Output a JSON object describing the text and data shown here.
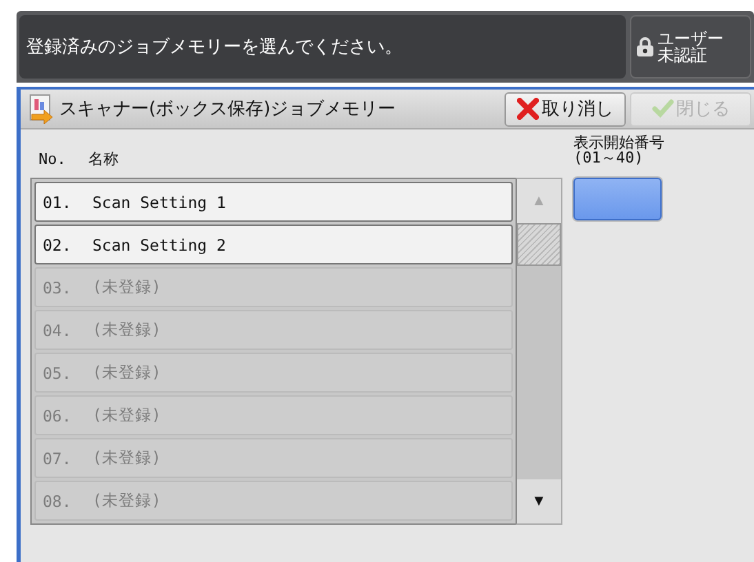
{
  "message": "登録済みのジョブメモリーを選んでください。",
  "user_button": {
    "line_1": "ユーザー",
    "line_2": "未認証"
  },
  "panel": {
    "title": "スキャナー(ボックス保存)ジョブメモリー",
    "buttons": [
      {
        "label": "取り消し",
        "kind": "cancel",
        "disabled": false
      },
      {
        "label": "閉じる",
        "kind": "close",
        "disabled": true
      }
    ]
  },
  "list": {
    "columns": [
      "No.",
      "名称"
    ],
    "rows": [
      {
        "number": "01.",
        "name": "Scan Setting 1",
        "disabled": false
      },
      {
        "number": "02.",
        "name": "Scan Setting 2",
        "disabled": false
      },
      {
        "number": "03.",
        "name": "(未登録)",
        "disabled": true
      },
      {
        "number": "04.",
        "name": "(未登録)",
        "disabled": true
      },
      {
        "number": "05.",
        "name": "(未登録)",
        "disabled": true
      },
      {
        "number": "06.",
        "name": "(未登録)",
        "disabled": true
      },
      {
        "number": "07.",
        "name": "(未登録)",
        "disabled": true
      },
      {
        "number": "08.",
        "name": "(未登録)",
        "disabled": true
      }
    ],
    "scroll_up": {
      "symbol": "▲",
      "disabled": true
    },
    "scroll_down": {
      "symbol": "▼",
      "disabled": false
    }
  },
  "start_number": {
    "label": "表示開始番号\n(01～40)"
  }
}
